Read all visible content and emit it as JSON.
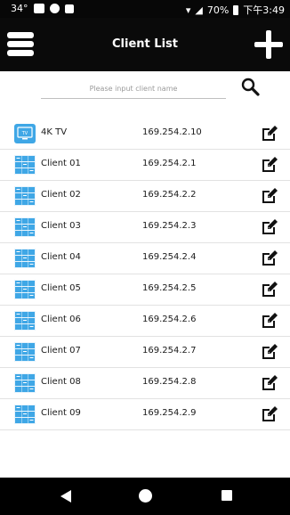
{
  "status_bar": {
    "temperature": "34°",
    "battery_percent": "70%",
    "time": "下午3:49"
  },
  "header": {
    "title": "Client List",
    "menu_icon": "hamburger-menu-icon",
    "add_icon": "plus-icon"
  },
  "search": {
    "placeholder": "Please input client name",
    "value": "",
    "icon": "search-icon"
  },
  "clients": [
    {
      "name": "4K TV",
      "ip": "169.254.2.10",
      "icon": "tv-icon"
    },
    {
      "name": "Client 01",
      "ip": "169.254.2.1",
      "icon": "video-wall-icon"
    },
    {
      "name": "Client 02",
      "ip": "169.254.2.2",
      "icon": "video-wall-icon"
    },
    {
      "name": "Client 03",
      "ip": "169.254.2.3",
      "icon": "video-wall-icon"
    },
    {
      "name": "Client 04",
      "ip": "169.254.2.4",
      "icon": "video-wall-icon"
    },
    {
      "name": "Client 05",
      "ip": "169.254.2.5",
      "icon": "video-wall-icon"
    },
    {
      "name": "Client 06",
      "ip": "169.254.2.6",
      "icon": "video-wall-icon"
    },
    {
      "name": "Client 07",
      "ip": "169.254.2.7",
      "icon": "video-wall-icon"
    },
    {
      "name": "Client 08",
      "ip": "169.254.2.8",
      "icon": "video-wall-icon"
    },
    {
      "name": "Client 09",
      "ip": "169.254.2.9",
      "icon": "video-wall-icon"
    }
  ],
  "colors": {
    "header_bg": "#0a0a0a",
    "icon_blue": "#3fa7e6",
    "divider": "#e2e2e2"
  }
}
